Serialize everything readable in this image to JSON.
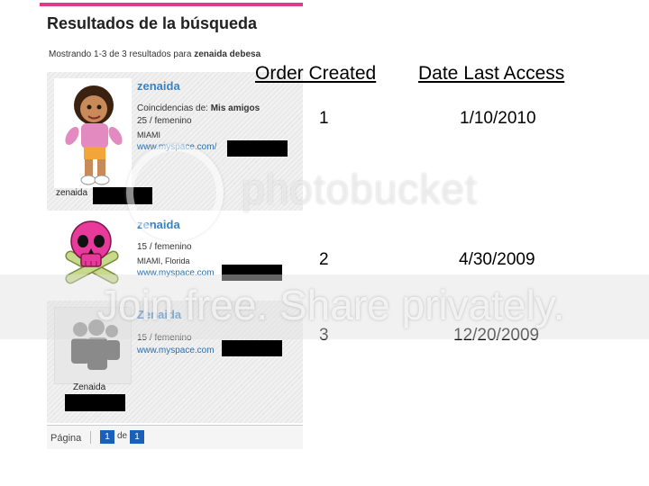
{
  "search": {
    "title": "Resultados de la búsqueda",
    "showing_prefix": "Mostrando 1-3 de 3 resultados para ",
    "query": "zenaida debesa"
  },
  "results": [
    {
      "name": "zenaida",
      "match_label": "Coincidencias de: ",
      "match_value": "Mis amigos",
      "age_gender": "25 / femenino",
      "location": "MIAMI",
      "url": "www.myspace.com/",
      "caption": "zenaida"
    },
    {
      "name": "zenaida",
      "age_gender": "15 / femenino",
      "location": "MIAMI, Florida",
      "url": "www.myspace.com"
    },
    {
      "name": "Zenaida",
      "age_gender": "15 / femenino",
      "url": "www.myspace.com",
      "caption": "Zenaida"
    }
  ],
  "pager": {
    "label": "Página",
    "current": "1",
    "of_label": "de",
    "total": "1"
  },
  "table": {
    "headers": [
      "Order Created",
      "Date Last Access"
    ],
    "rows": [
      {
        "order": "1",
        "date": "1/10/2010"
      },
      {
        "order": "2",
        "date": "4/30/2009"
      },
      {
        "order": "3",
        "date": "12/20/2009"
      }
    ]
  },
  "watermark": {
    "logo": "photobucket",
    "tagline": "Join free. Share privately."
  },
  "colors": {
    "accent_bar": "#e0388a",
    "link": "#3a82c4",
    "pager_box": "#1c5fb8"
  }
}
